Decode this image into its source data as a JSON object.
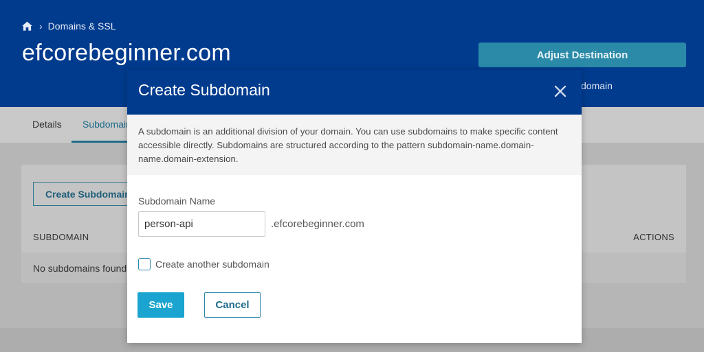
{
  "breadcrumb": {
    "home_icon": "home-icon",
    "separator": "›",
    "current": "Domains & SSL"
  },
  "page": {
    "title": "efcorebeginner.com",
    "adjust_destination_label": "Adjust Destination",
    "header_fragment": "domain"
  },
  "tabs": [
    {
      "label": "Details"
    },
    {
      "label": "Subdomains"
    }
  ],
  "subdomains_card": {
    "create_button_label": "Create Subdomain",
    "columns": [
      "SUBDOMAIN",
      "ACTIONS"
    ],
    "empty_text": "No subdomains found"
  },
  "modal": {
    "title": "Create Subdomain",
    "close_icon": "close-icon",
    "description": "A subdomain is an additional division of your domain. You can use subdomains to make specific content accessible directly. Subdomains are structured according to the pattern subdomain-name.domain-name.domain-extension.",
    "field_label": "Subdomain Name",
    "field_value": "person-api",
    "domain_suffix": ".efcorebeginner.com",
    "checkbox_label": "Create another subdomain",
    "checkbox_checked": false,
    "save_label": "Save",
    "cancel_label": "Cancel"
  },
  "colors": {
    "header_blue": "#003b8e",
    "accent_teal": "#1aa4cf",
    "link_teal": "#1f6d8c",
    "overlay_grey": "#b8b8b8"
  }
}
